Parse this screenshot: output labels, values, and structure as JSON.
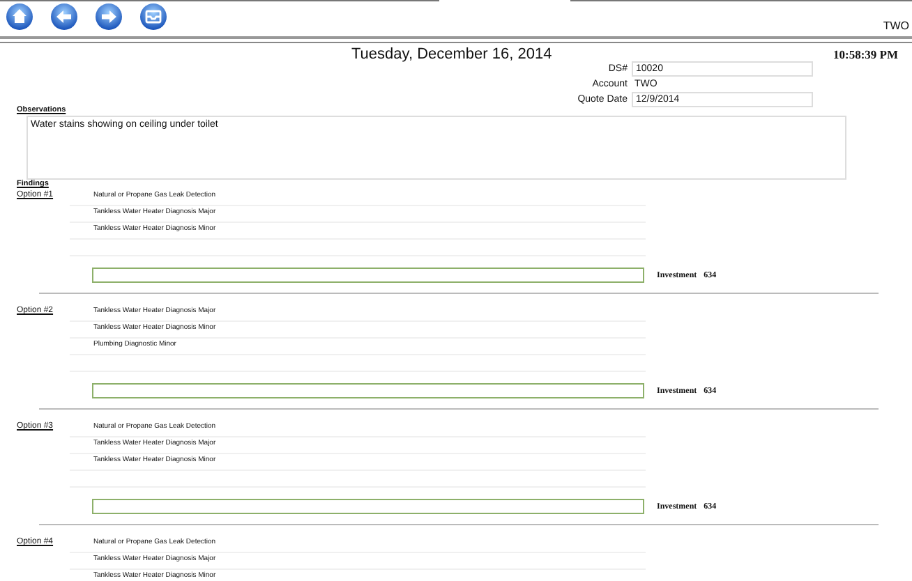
{
  "toolbar": {
    "buttons": [
      {
        "kind": "home"
      },
      {
        "kind": "back"
      },
      {
        "kind": "forward"
      },
      {
        "kind": "tray"
      }
    ],
    "account_label": "TWO"
  },
  "header": {
    "date": "Tuesday, December 16, 2014",
    "time": "10:58:39 PM"
  },
  "fields": [
    {
      "label": "DS#",
      "value": "10020",
      "boxed": true
    },
    {
      "label": "Account",
      "value": "TWO",
      "boxed": false
    },
    {
      "label": "Quote Date",
      "value": "12/9/2014",
      "boxed": true
    }
  ],
  "observations": {
    "label": "Observations",
    "text": "Water stains showing on ceiling under toilet"
  },
  "findings_label": "Findings",
  "options": [
    {
      "label": "Option #1",
      "items": [
        "Natural or Propane Gas Leak Detection",
        "Tankless Water Heater Diagnosis Major",
        "Tankless Water Heater Diagnosis Minor"
      ],
      "investment_label": "Investment",
      "investment": "634"
    },
    {
      "label": "Option #2",
      "items": [
        "Tankless Water Heater Diagnosis Major",
        "Tankless Water Heater Diagnosis Minor",
        "Plumbing Diagnostic Minor"
      ],
      "investment_label": "Investment",
      "investment": "634"
    },
    {
      "label": "Option #3",
      "items": [
        "Natural or Propane Gas Leak Detection",
        "Tankless Water Heater Diagnosis Major",
        "Tankless Water Heater Diagnosis Minor"
      ],
      "investment_label": "Investment",
      "investment": "634"
    },
    {
      "label": "Option #4",
      "items": [
        "Natural or Propane Gas Leak Detection",
        "Tankless Water Heater Diagnosis Major",
        "Tankless Water Heater Diagnosis Minor"
      ]
    }
  ]
}
